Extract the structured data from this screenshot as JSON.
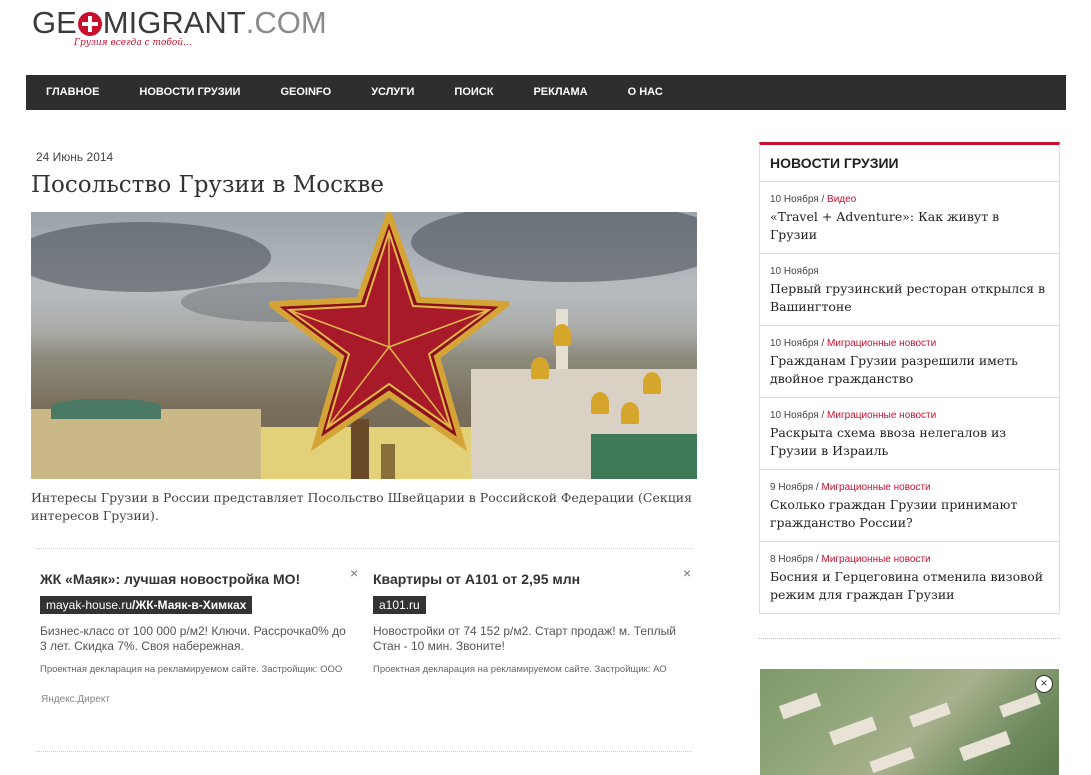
{
  "logo": {
    "part1": "GE",
    "part2": "MIGRANT",
    "part3": ".COM",
    "tagline": "Грузия всегда с тобой..."
  },
  "nav": [
    "Главное",
    "Новости Грузии",
    "GEOINFO",
    "Услуги",
    "Поиск",
    "Реклама",
    "О нас"
  ],
  "article": {
    "date": "24 Июнь 2014",
    "title": "Посольство Грузии в Москве",
    "caption": "Интересы Грузии в России представляет Посольство Швейцарии в Российской Федерации (Секция интересов Грузии)."
  },
  "ads": [
    {
      "title": "ЖК «Маяк»: лучшая новостройка МО!",
      "url_domain": "mayak-house.ru",
      "url_path": "/ЖК-Маяк-в-Химках",
      "text": "Бизнес-класс от 100 000 р/м2! Ключи. Рассрочка0% до 3 лет. Скидка 7%. Своя набережная.",
      "disclaimer": "Проектная декларация на рекламируемом сайте. Застройщик: ООО",
      "close": "×"
    },
    {
      "title": "Квартиры от А101 от 2,95 млн",
      "url_domain": "a101.ru",
      "url_path": "",
      "text": "Новостройки от 74 152 р/м2. Старт продаж! м. Теплый Стан - 10 мин. Звоните!",
      "disclaimer": "Проектная декларация на рекламируемом сайте. Застройщик: АО",
      "close": "×"
    }
  ],
  "ads_provider": "Яндекс.Директ",
  "sidebar": {
    "title": "Новости Грузии",
    "items": [
      {
        "date": "10 Ноября",
        "category": "Видео",
        "title": "«Travel + Adventure»: Как живут в Грузии"
      },
      {
        "date": "10 Ноября",
        "category": "",
        "title": "Первый грузинский ресторан открылся в Вашингтоне"
      },
      {
        "date": "10 Ноября",
        "category": "Миграционные новости",
        "title": "Гражданам Грузии разрешили иметь двойное гражданство"
      },
      {
        "date": "10 Ноября",
        "category": "Миграционные новости",
        "title": "Раскрыта схема ввоза нелегалов из Грузии в Израиль"
      },
      {
        "date": "9 Ноября",
        "category": "Миграционные новости",
        "title": "Сколько граждан Грузии принимают гражданство России?"
      },
      {
        "date": "8 Ноября",
        "category": "Миграционные новости",
        "title": "Босния и Герцеговина отменила визовой режим для граждан Грузии"
      }
    ],
    "banner_close": "×"
  },
  "colors": {
    "accent": "#c8102e",
    "nav_bg": "#2e2e2e"
  }
}
